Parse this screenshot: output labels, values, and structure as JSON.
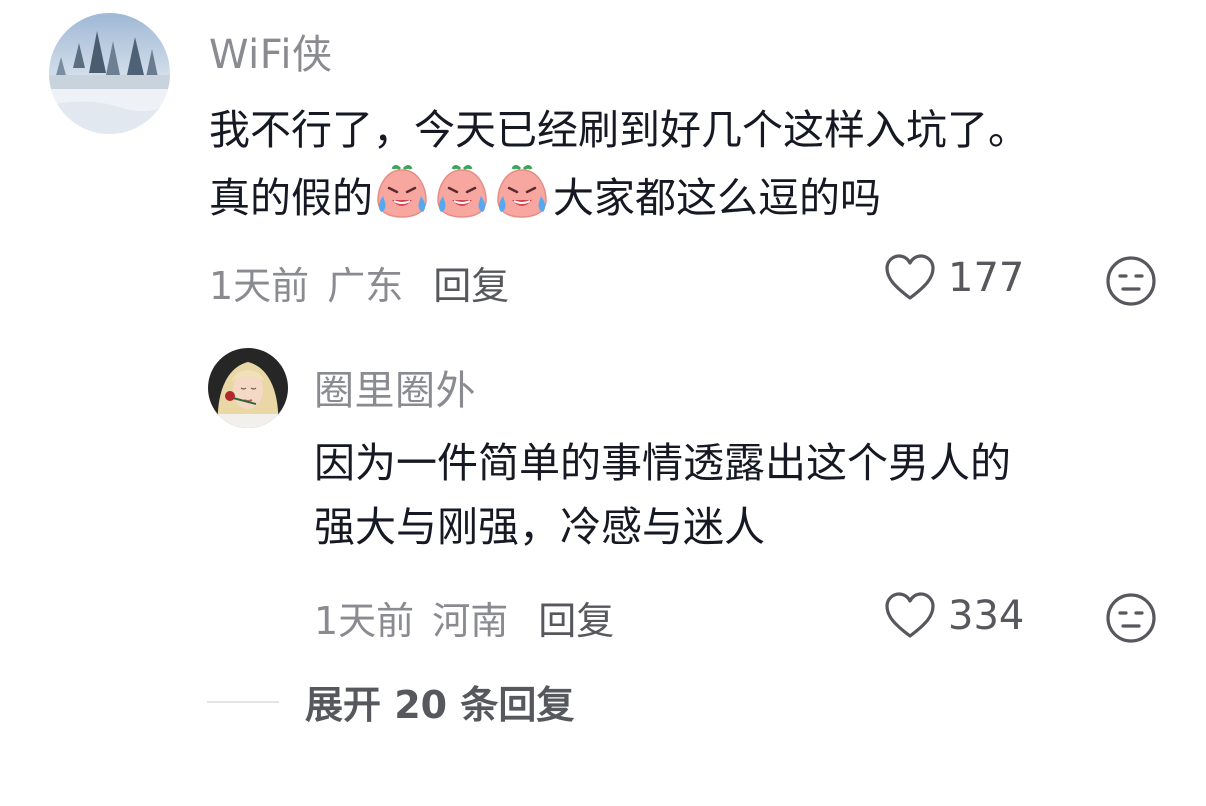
{
  "comments": [
    {
      "username": "WiFi侠",
      "line1": "我不行了，今天已经刷到好几个这样入坑了。",
      "line2_before": "真的假的",
      "line2_after": "大家都这么逗的吗",
      "emojis": [
        "crying-emoji",
        "crying-emoji",
        "crying-emoji"
      ],
      "time": "1天前",
      "location": "广东",
      "reply_label": "回复",
      "likes": "177"
    }
  ],
  "replies": [
    {
      "username": "圈里圈外",
      "line1": "因为一件简单的事情透露出这个男人的",
      "line2": "强大与刚强，冷感与迷人",
      "time": "1天前",
      "location": "河南",
      "reply_label": "回复",
      "likes": "334"
    }
  ],
  "expand_label": "展开 20 条回复",
  "colors": {
    "primary_text": "#161823",
    "secondary_text": "#8a8b91",
    "action_text": "#57585e"
  }
}
